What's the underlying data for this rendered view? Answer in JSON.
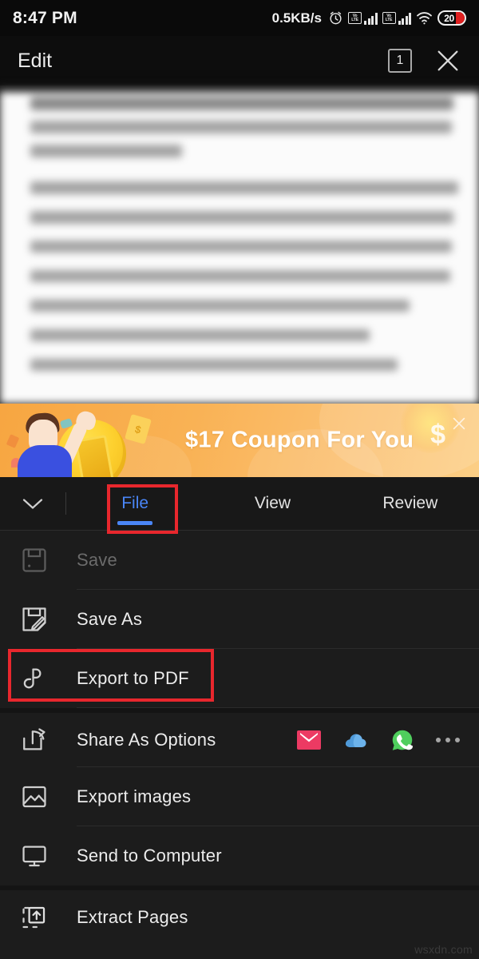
{
  "status_bar": {
    "time": "8:47 PM",
    "network_speed": "0.5KB/s",
    "alarm_icon": "alarm-clock-icon",
    "volte_top": "Vo",
    "volte_bottom": "LTE",
    "sim1_signal": "signal-bars-icon",
    "sim2_signal": "signal-bars-icon",
    "wifi_icon": "wifi-icon",
    "battery_percent": "20"
  },
  "app_bar": {
    "title": "Edit",
    "tab_count": "1",
    "close_icon": "close-icon"
  },
  "document": {
    "description": "blurred document text page"
  },
  "coupon_banner": {
    "text": "$17 Coupon For You",
    "currency_symbol": "$",
    "bill_symbol": "$",
    "close_icon": "close-icon",
    "accent_color": "#f9b255"
  },
  "ribbon": {
    "collapse_icon": "chevron-down-icon",
    "tabs": [
      {
        "label": "File",
        "active": true
      },
      {
        "label": "View",
        "active": false
      },
      {
        "label": "Review",
        "active": false
      }
    ],
    "active_color": "#4a86f7"
  },
  "menu": {
    "items": [
      {
        "label": "Save",
        "icon": "floppy-disk-icon",
        "disabled": true
      },
      {
        "label": "Save As",
        "icon": "save-as-icon",
        "disabled": false
      },
      {
        "label": "Export to PDF",
        "icon": "export-pdf-icon",
        "disabled": false
      },
      {
        "label": "Share As Options",
        "icon": "share-icon",
        "disabled": false
      },
      {
        "label": "Export images",
        "icon": "image-icon",
        "disabled": false
      },
      {
        "label": "Send to Computer",
        "icon": "monitor-icon",
        "disabled": false
      },
      {
        "label": "Extract Pages",
        "icon": "extract-pages-icon",
        "disabled": false
      }
    ],
    "share_targets": [
      {
        "name": "mail-icon",
        "color": "#ec3a63"
      },
      {
        "name": "cloud-icon",
        "color": "#5aa9e6"
      },
      {
        "name": "whatsapp-icon",
        "color": "#4fce5d"
      },
      {
        "name": "more-icon",
        "color": "#a5a5a5"
      }
    ]
  },
  "annotations": {
    "highlight_color": "#e8272d",
    "targets": [
      "File",
      "Export to PDF"
    ]
  },
  "watermark": {
    "text": "wsxdn.com"
  }
}
